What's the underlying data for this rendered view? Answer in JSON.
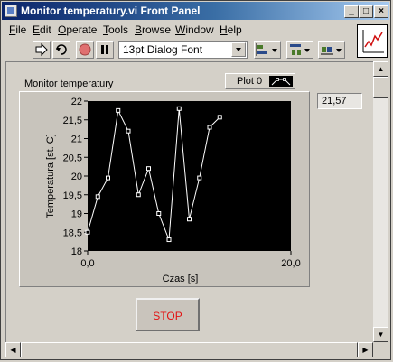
{
  "window": {
    "title": "Monitor temperatury.vi Front Panel",
    "controls": {
      "minimize": "_",
      "maximize": "□",
      "close": "×"
    }
  },
  "menu": {
    "items": [
      {
        "label": "File",
        "mnemonic": "F",
        "rest": "ile"
      },
      {
        "label": "Edit",
        "mnemonic": "E",
        "rest": "dit"
      },
      {
        "label": "Operate",
        "mnemonic": "O",
        "rest": "perate"
      },
      {
        "label": "Tools",
        "mnemonic": "T",
        "rest": "ools"
      },
      {
        "label": "Browse",
        "mnemonic": "B",
        "rest": "rowse"
      },
      {
        "label": "Window",
        "mnemonic": "W",
        "rest": "indow"
      },
      {
        "label": "Help",
        "mnemonic": "H",
        "rest": "elp"
      }
    ]
  },
  "toolbar": {
    "run_icon": "run-arrow-icon",
    "run_continuous_icon": "run-continuously-icon",
    "abort_icon": "abort-execution-icon",
    "pause_icon": "pause-icon",
    "font_select": "13pt Dialog Font",
    "align_icon": "align-objects-icon",
    "distribute_icon": "distribute-objects-icon",
    "reorder_icon": "reorder-objects-icon"
  },
  "graph": {
    "label": "Monitor temperatury",
    "legend_plot_name": "Plot 0",
    "colors": {
      "plot_bg": "#000000",
      "trace": "#ffffff",
      "frame": "#c8c4bc"
    }
  },
  "digital_indicator": {
    "value": "21,57"
  },
  "stop_button": {
    "label": "STOP",
    "text_color": "#e21313"
  },
  "chart_data": {
    "type": "line",
    "title": "Monitor temperatury",
    "xlabel": "Czas [s]",
    "ylabel": "Temperatura [st. C]",
    "xlim": [
      0,
      20
    ],
    "ylim": [
      18,
      22
    ],
    "x_ticks": [
      "0,0",
      "20,0"
    ],
    "y_ticks": [
      "18",
      "18,5",
      "19",
      "19,5",
      "20",
      "20,5",
      "21",
      "21,5",
      "22"
    ],
    "grid": false,
    "series": [
      {
        "name": "Plot 0",
        "x": [
          0,
          1,
          2,
          3,
          4,
          5,
          6,
          7,
          8,
          9,
          10,
          11,
          12,
          13
        ],
        "values": [
          18.5,
          19.45,
          19.95,
          21.75,
          21.2,
          19.5,
          20.2,
          19.0,
          18.3,
          21.8,
          18.85,
          19.95,
          21.3,
          21.57
        ]
      }
    ]
  }
}
